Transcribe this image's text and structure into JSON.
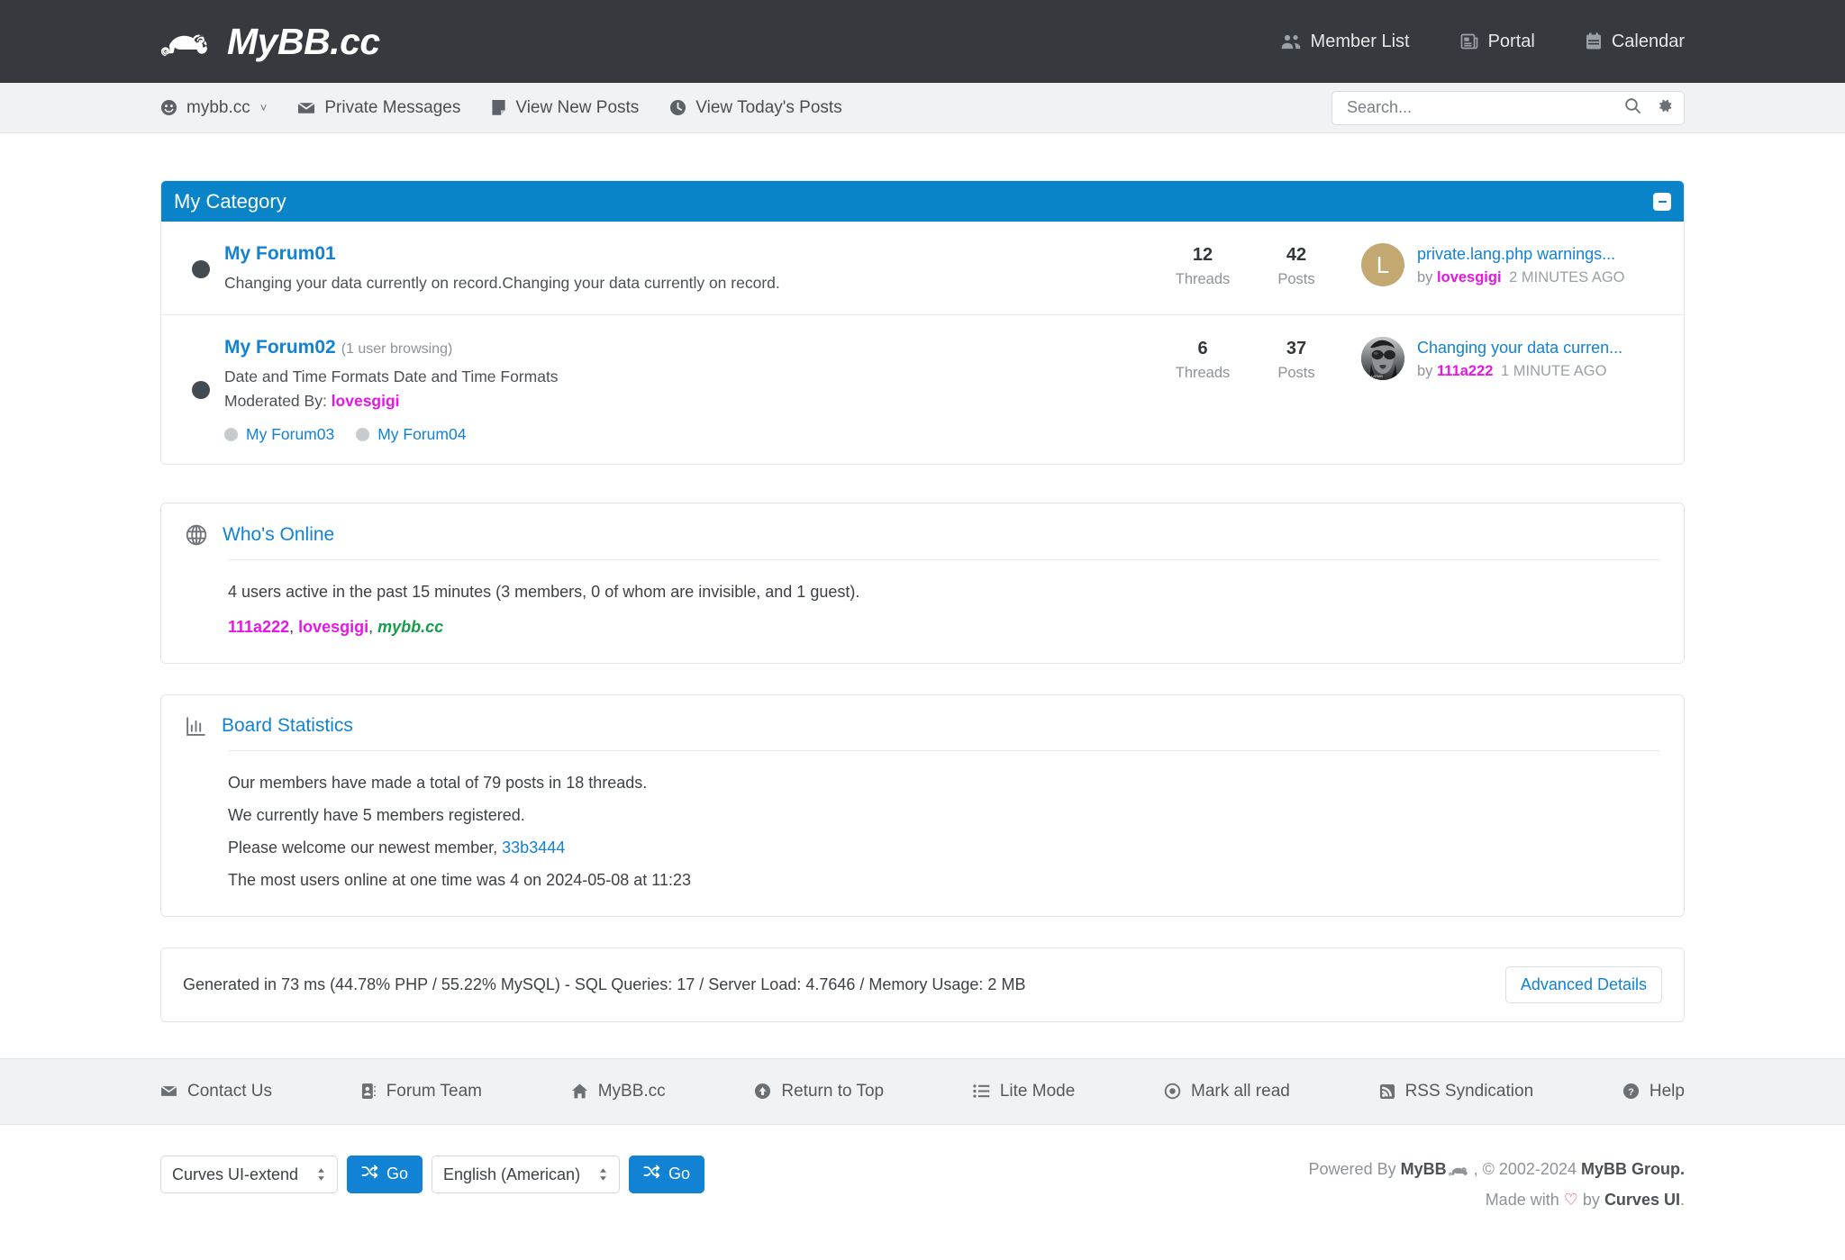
{
  "header": {
    "brand": "MyBB.cc",
    "brand_icon": "chameleon-logo-icon",
    "nav": [
      {
        "label": "Member List",
        "icon": "users-icon"
      },
      {
        "label": "Portal",
        "icon": "newspaper-icon"
      },
      {
        "label": "Calendar",
        "icon": "calendar-icon"
      }
    ]
  },
  "subnav": {
    "items": [
      {
        "label": "mybb.cc",
        "icon": "smiley-icon",
        "caret": "˅"
      },
      {
        "label": "Private Messages",
        "icon": "envelope-icon"
      },
      {
        "label": "View New Posts",
        "icon": "note-icon"
      },
      {
        "label": "View Today's Posts",
        "icon": "clock-icon"
      }
    ],
    "search": {
      "placeholder": "Search...",
      "value": "",
      "search_icon": "search-icon",
      "settings_icon": "gear-icon"
    }
  },
  "category": {
    "title": "My Category",
    "collapse_icon": "minus-icon",
    "accent": "#0a84c8",
    "forums": [
      {
        "title": "My Forum01",
        "browsing": "",
        "description": "Changing your data currently on record.Changing your data currently on record.",
        "moderated_label": "",
        "moderators": [],
        "subforums": [],
        "threads": "12",
        "threads_label": "Threads",
        "posts": "42",
        "posts_label": "Posts",
        "last_post": {
          "title": "private.lang.php warnings...",
          "by_label": "by",
          "author": "lovesgigi",
          "ago": "2 MINUTES AGO",
          "avatar_letter": "L",
          "avatar_color": "#c3a971",
          "avatar_type": "letter"
        }
      },
      {
        "title": "My Forum02",
        "browsing": "(1 user browsing)",
        "description": "Date and Time Formats Date and Time Formats",
        "moderated_label": "Moderated By:",
        "moderators": [
          "lovesgigi"
        ],
        "subforums": [
          "My Forum03",
          "My Forum04"
        ],
        "threads": "6",
        "threads_label": "Threads",
        "posts": "37",
        "posts_label": "Posts",
        "last_post": {
          "title": "Changing your data curren...",
          "by_label": "by",
          "author": "111a222",
          "ago": "1 MINUTE AGO",
          "avatar_letter": "",
          "avatar_color": "#58595b",
          "avatar_type": "photo"
        }
      }
    ]
  },
  "whos_online": {
    "icon": "globe-icon",
    "title": "Who's Online",
    "summary": "4 users active in the past 15 minutes (3 members, 0 of whom are invisible, and 1 guest).",
    "users": [
      {
        "name": "111a222",
        "style": "pink"
      },
      {
        "name": "lovesgigi",
        "style": "pink"
      },
      {
        "name": "mybb.cc",
        "style": "green"
      }
    ]
  },
  "board_statistics": {
    "icon": "bar-chart-icon",
    "title": "Board Statistics",
    "lines": [
      "Our members have made a total of 79 posts in 18 threads.",
      "We currently have 5 members registered."
    ],
    "newest_member_prefix": "Please welcome our newest member,",
    "newest_member": "33b3444",
    "most_users_line": "The most users online at one time was 4 on 2024-05-08 at 11:23"
  },
  "generated": {
    "text": "Generated in 73 ms (44.78% PHP / 55.22% MySQL) - SQL Queries: 17 / Server Load: 4.7646 / Memory Usage: 2 MB",
    "advanced_details": "Advanced Details"
  },
  "footer": {
    "links": [
      {
        "label": "Contact Us",
        "icon": "envelope-icon"
      },
      {
        "label": "Forum Team",
        "icon": "id-card-icon"
      },
      {
        "label": "MyBB.cc",
        "icon": "home-icon"
      },
      {
        "label": "Return to Top",
        "icon": "arrow-up-circle-icon"
      },
      {
        "label": "Lite Mode",
        "icon": "list-icon"
      },
      {
        "label": "Mark all read",
        "icon": "circle-dot-icon"
      },
      {
        "label": "RSS Syndication",
        "icon": "rss-icon"
      },
      {
        "label": "Help",
        "icon": "question-circle-icon"
      }
    ],
    "theme_select": {
      "value": "Curves UI-extend",
      "go_label": "Go",
      "go_icon": "shuffle-icon"
    },
    "language_select": {
      "value": "English (American)",
      "go_label": "Go",
      "go_icon": "shuffle-icon"
    },
    "credits": {
      "powered_prefix": "Powered By",
      "powered_brand": "MyBB",
      "copyright": ", © 2002-2024",
      "group": "MyBB Group.",
      "made_prefix": "Made with",
      "heart": "♡",
      "made_mid": "by",
      "made_brand": "Curves UI",
      "made_suffix": "."
    }
  }
}
